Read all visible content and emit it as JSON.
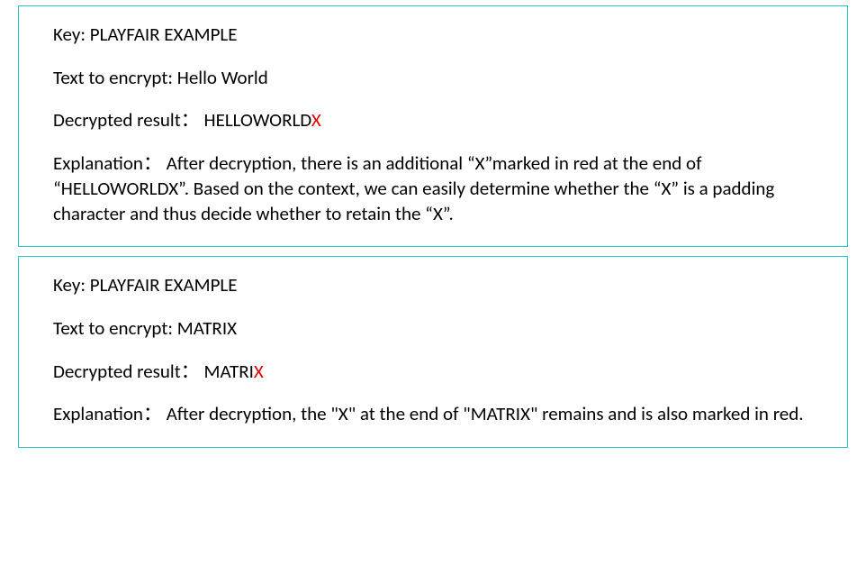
{
  "boxes": [
    {
      "key_label": "Key: ",
      "key_value": "PLAYFAIR EXAMPLE",
      "text_label": "Text to encrypt: ",
      "text_value": "Hello World",
      "decrypted_label": "Decrypted result：",
      "decrypted_prefix": "HELLOWORLD",
      "decrypted_red": "X",
      "explanation_label": "Explanation：",
      "explanation_text": "After decryption, there is an additional “X”marked in red at the end of “HELLOWORLDX”. Based on the context, we can easily determine whether the “X” is a padding character and thus decide whether to retain the “X”."
    },
    {
      "key_label": "Key: ",
      "key_value": "PLAYFAIR EXAMPLE",
      "text_label": "Text to encrypt: ",
      "text_value": "MATRIX",
      "decrypted_label": "Decrypted result：",
      "decrypted_prefix": "MATRI",
      "decrypted_red": "X",
      "explanation_label": "Explanation：",
      "explanation_text": "After decryption, the \"X\" at the end of \"MATRIX\" remains and is also marked in red."
    }
  ]
}
